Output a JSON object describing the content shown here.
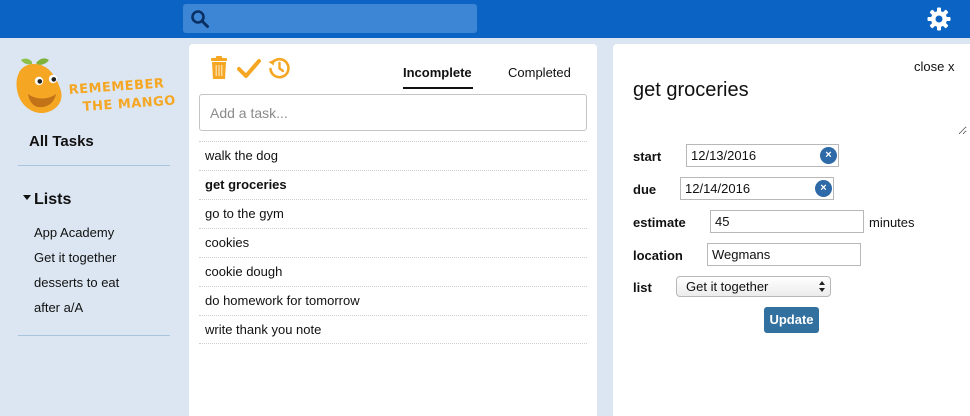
{
  "header": {
    "search_placeholder": "",
    "search_icon": "search-icon",
    "settings_icon": "gear-icon"
  },
  "sidebar": {
    "logo_line1": "REMEMEBER",
    "logo_line2": "THE MANGO",
    "all_tasks": "All Tasks",
    "lists_heading": "Lists",
    "lists": [
      "App Academy",
      "Get it together",
      "desserts to eat",
      "after a/A"
    ]
  },
  "tasks": {
    "toolbar_icons": [
      "trash-icon",
      "check-icon",
      "history-icon"
    ],
    "tabs": [
      {
        "label": "Incomplete",
        "active": true
      },
      {
        "label": "Completed",
        "active": false
      }
    ],
    "add_placeholder": "Add a task...",
    "items": [
      "walk the dog",
      "get groceries",
      "go to the gym",
      "cookies",
      "cookie dough",
      "do homework for tomorrow",
      "write thank you note"
    ],
    "selected": "get groceries"
  },
  "detail": {
    "close_label": "close x",
    "title": "get groceries",
    "start_label": "start",
    "start_value": "12/13/2016",
    "due_label": "due",
    "due_value": "12/14/2016",
    "estimate_label": "estimate",
    "estimate_value": "45",
    "estimate_unit": "minutes",
    "location_label": "location",
    "location_value": "Wegmans",
    "list_label": "list",
    "list_value": "Get it together",
    "update_label": "Update"
  },
  "colors": {
    "topbar": "#0b63c4",
    "search": "#3d86d6",
    "sidebar": "#dbe6f2",
    "accent_orange": "#f5a623",
    "update_button": "#31709f"
  }
}
